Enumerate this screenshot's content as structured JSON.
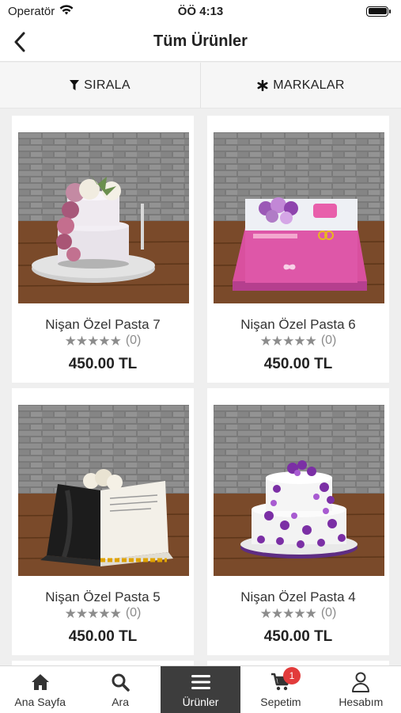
{
  "status_bar": {
    "carrier": "Operatör",
    "time": "ÖÖ 4:13"
  },
  "nav": {
    "title": "Tüm Ürünler"
  },
  "filters": {
    "sort_label": "SIRALA",
    "brands_label": "MARKALAR"
  },
  "products": [
    {
      "name": "Nişan Özel Pasta 7",
      "stars": "★★★★★",
      "reviews": "(0)",
      "price": "450.00 TL"
    },
    {
      "name": "Nişan Özel Pasta 6",
      "stars": "★★★★★",
      "reviews": "(0)",
      "price": "450.00 TL"
    },
    {
      "name": "Nişan Özel Pasta 5",
      "stars": "★★★★★",
      "reviews": "(0)",
      "price": "450.00 TL"
    },
    {
      "name": "Nişan Özel Pasta 4",
      "stars": "★★★★★",
      "reviews": "(0)",
      "price": "450.00 TL"
    }
  ],
  "tabs": [
    {
      "label": "Ana Sayfa",
      "icon": "home-icon"
    },
    {
      "label": "Ara",
      "icon": "search-icon"
    },
    {
      "label": "Ürünler",
      "icon": "menu-icon",
      "active": true
    },
    {
      "label": "Sepetim",
      "icon": "cart-icon",
      "badge": "1"
    },
    {
      "label": "Hesabım",
      "icon": "user-icon"
    }
  ],
  "colors": {
    "accent_active_tab": "#3d3d3d",
    "badge": "#e23b3b",
    "rating_star": "#8c8c8c"
  }
}
